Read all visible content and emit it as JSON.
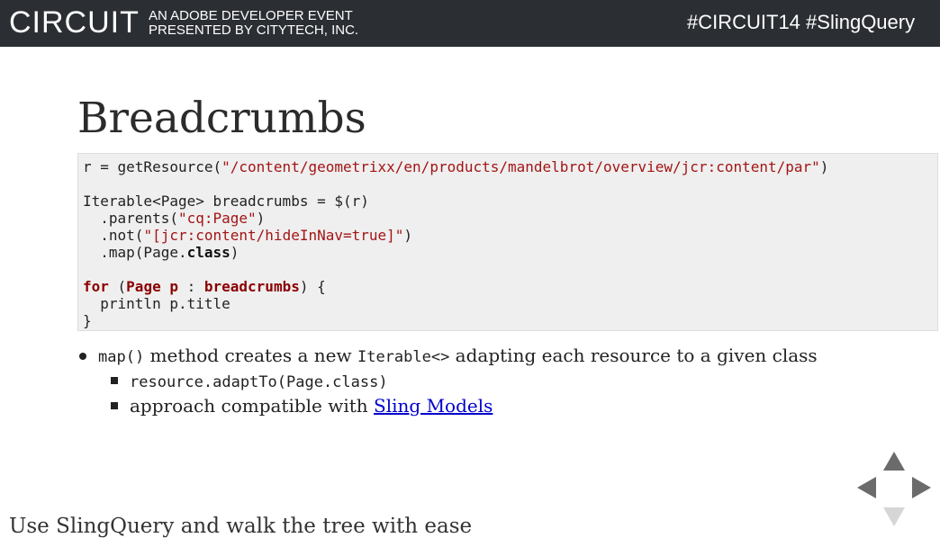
{
  "header": {
    "brand": "CIRCUIT",
    "subtitle_line1": "AN ADOBE DEVELOPER EVENT",
    "subtitle_line2": "PRESENTED BY CITYTECH, INC.",
    "hashtags": "#CIRCUIT14 #SlingQuery"
  },
  "slide": {
    "title": "Breadcrumbs",
    "code": {
      "l1_a": "r = getResource(",
      "l1_str": "\"/content/geometrixx/en/products/mandelbrot/overview/jcr:content/par\"",
      "l1_b": ")",
      "l3": "Iterable<Page> breadcrumbs = $(r)",
      "l4_a": "  .parents(",
      "l4_str": "\"cq:Page\"",
      "l4_b": ")",
      "l5_a": "  .not(",
      "l5_str": "\"[jcr:content/hideInNav=true]\"",
      "l5_b": ")",
      "l6_a": "  .map(Page.",
      "l6_kw": "class",
      "l6_b": ")",
      "l8_for": "for",
      "l8_a": " (",
      "l8_page": "Page p",
      "l8_b": " : ",
      "l8_bc": "breadcrumbs",
      "l8_c": ") {",
      "l9": "  println p.title",
      "l10": "}"
    },
    "bullets": {
      "b1_code1": "map()",
      "b1_text1": " method creates a new ",
      "b1_code2": "Iterable<>",
      "b1_text2": " adapting each resource to a given class",
      "b2_code": "resource.adaptTo(Page.class)",
      "b3_text": "approach compatible with ",
      "b3_link": "Sling Models"
    }
  },
  "footer": {
    "text": "Use SlingQuery and walk the tree with ease"
  },
  "nav": {
    "up": "arrow-up-icon",
    "left": "arrow-left-icon",
    "right": "arrow-right-icon",
    "down": "arrow-down-icon"
  }
}
